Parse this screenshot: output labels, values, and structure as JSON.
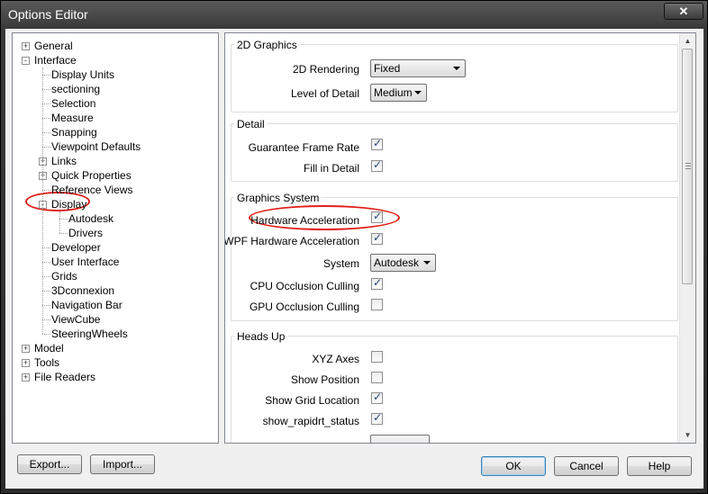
{
  "window": {
    "title": "Options Editor",
    "close_glyph": "✕"
  },
  "tree": {
    "items": [
      {
        "label": "General",
        "level": 0,
        "expander": "+"
      },
      {
        "label": "Interface",
        "level": 0,
        "expander": "-"
      },
      {
        "label": "Display Units",
        "level": 1
      },
      {
        "label": "sectioning",
        "level": 1
      },
      {
        "label": "Selection",
        "level": 1
      },
      {
        "label": "Measure",
        "level": 1
      },
      {
        "label": "Snapping",
        "level": 1
      },
      {
        "label": "Viewpoint Defaults",
        "level": 1
      },
      {
        "label": "Links",
        "level": 1,
        "expander": "+"
      },
      {
        "label": "Quick Properties",
        "level": 1,
        "expander": "+"
      },
      {
        "label": "Reference Views",
        "level": 1
      },
      {
        "label": "Display",
        "level": 1,
        "expander": "-"
      },
      {
        "label": "Autodesk",
        "level": 2
      },
      {
        "label": "Drivers",
        "level": 2
      },
      {
        "label": "Developer",
        "level": 1
      },
      {
        "label": "User Interface",
        "level": 1
      },
      {
        "label": "Grids",
        "level": 1
      },
      {
        "label": "3Dconnexion",
        "level": 1
      },
      {
        "label": "Navigation Bar",
        "level": 1
      },
      {
        "label": "ViewCube",
        "level": 1
      },
      {
        "label": "SteeringWheels",
        "level": 1
      },
      {
        "label": "Model",
        "level": 0,
        "expander": "+"
      },
      {
        "label": "Tools",
        "level": 0,
        "expander": "+"
      },
      {
        "label": "File Readers",
        "level": 0,
        "expander": "+"
      }
    ]
  },
  "panel": {
    "graphics2d": {
      "title": "2D Graphics",
      "rendering_label": "2D Rendering",
      "rendering_value": "Fixed",
      "lod_label": "Level of Detail",
      "lod_value": "Medium"
    },
    "detail": {
      "title": "Detail",
      "frame_rate_label": "Guarantee Frame Rate",
      "frame_rate_checked": true,
      "fill_label": "Fill in Detail",
      "fill_checked": true
    },
    "graphics_system": {
      "title": "Graphics System",
      "hw_label": "Hardware Acceleration",
      "hw_checked": true,
      "wpf_label": "WPF Hardware Acceleration",
      "wpf_checked": true,
      "system_label": "System",
      "system_value": "Autodesk",
      "cpu_label": "CPU Occlusion Culling",
      "cpu_checked": true,
      "gpu_label": "GPU Occlusion Culling",
      "gpu_checked": false
    },
    "heads_up": {
      "title": "Heads Up",
      "xyz_label": "XYZ Axes",
      "xyz_checked": false,
      "pos_label": "Show Position",
      "pos_checked": false,
      "grid_label": "Show Grid Location",
      "grid_checked": true,
      "rapid_label": "show_rapidrt_status",
      "rapid_checked": true
    }
  },
  "buttons": {
    "export": "Export...",
    "import": "Import...",
    "ok": "OK",
    "cancel": "Cancel",
    "help": "Help"
  },
  "colors": {
    "annotation": "#e0201a",
    "frame": "#2b2b2b",
    "dialog": "#f0f0f0"
  }
}
